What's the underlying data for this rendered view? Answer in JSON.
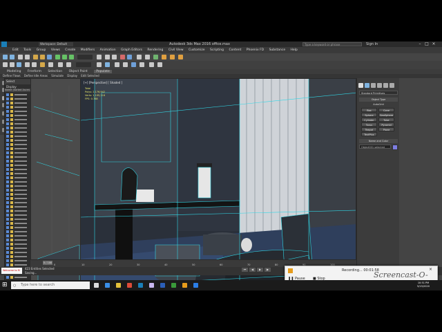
{
  "titlebar": {
    "app_title": "Autodesk 3ds Max 2016  office.max",
    "workspace": "Workspace: Default",
    "search_placeholder": "Type a keyword or phrase",
    "sign_in": "Sign In"
  },
  "menu": {
    "items": [
      "Edit",
      "Tools",
      "Group",
      "Views",
      "Create",
      "Modifiers",
      "Animation",
      "Graph Editors",
      "Rendering",
      "Civil View",
      "Customize",
      "Scripting",
      "Content",
      "Phoenix FD",
      "Substance",
      "Help"
    ]
  },
  "ribbon": {
    "tabs": [
      "Modeling",
      "Freeform",
      "Selection",
      "Object Paint",
      "Populate"
    ],
    "active_tab": "Populate",
    "sub_items": [
      "Define Flows",
      "Define Idle Areas",
      "Simulate",
      "Display",
      "Edit Selected"
    ]
  },
  "viewport": {
    "label": "[+] [Perspective] [ Shaded ]",
    "stats": [
      "Total",
      "Polys: 2,176,942",
      "Verts: 1,105,118",
      "FPS: 0.788"
    ]
  },
  "scene_explorer": {
    "tabs": [
      "Select",
      "Display"
    ],
    "header": "Name (Sorted Ascen..."
  },
  "command_panel": {
    "dropdown": "Standard Primitives",
    "object_type_title": "Object Type",
    "autogrid": "AutoGrid",
    "buttons": [
      "Box",
      "Cone",
      "Sphere",
      "GeoSphere",
      "Cylinder",
      "Tube",
      "Torus",
      "Pyramid",
      "Teapot",
      "Plane",
      "TextPlus"
    ],
    "name_color_title": "Name and Color",
    "name_value": "Object001 selected"
  },
  "timeline": {
    "frame": "0 / 100",
    "ticks": [
      "0",
      "10",
      "20",
      "30",
      "40",
      "50",
      "60",
      "70",
      "80",
      "90",
      "100"
    ]
  },
  "status": {
    "selection": "423 Entities Selected",
    "prompt": "Saving...",
    "script_label": "Welcome to M"
  },
  "recorder": {
    "title": "Recording... 00:01:58",
    "pause": "Pause",
    "stop": "Stop",
    "brand": "Screencast-O-Matic"
  },
  "taskbar": {
    "search_placeholder": "Type here to search",
    "time": "10:51 PM",
    "date": "5/15/2020"
  },
  "colors": {
    "wire_cyan": "#30d7e6",
    "viewport_bg": "#1f2633"
  }
}
